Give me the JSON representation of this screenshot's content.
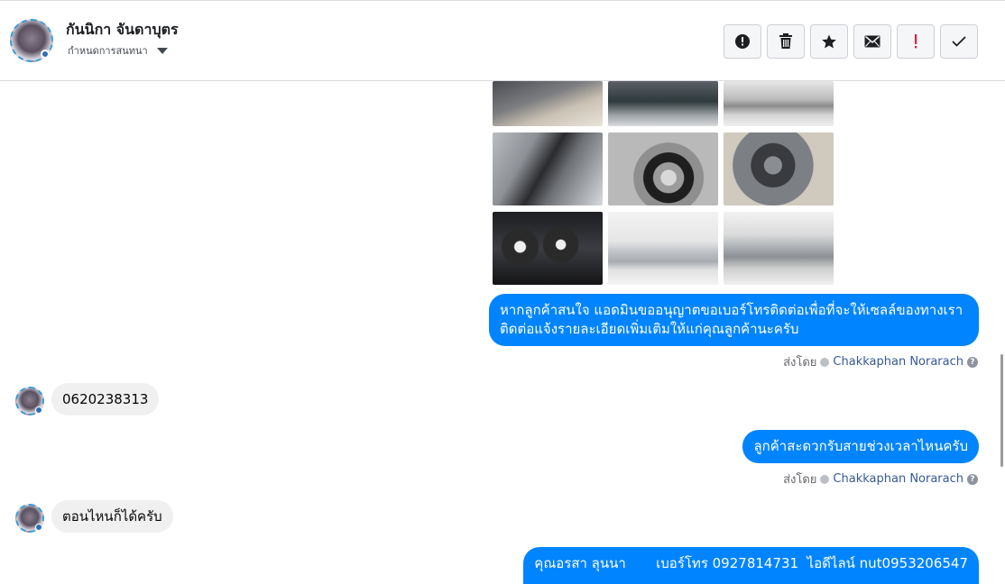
{
  "header": {
    "name": "กันนิกา จันดาบุตร",
    "subtitle": "กำหนดการสนทนา",
    "actions": [
      {
        "id": "spam",
        "icon": "alert-circle-icon"
      },
      {
        "id": "delete",
        "icon": "trash-icon"
      },
      {
        "id": "star",
        "icon": "star-icon"
      },
      {
        "id": "mail",
        "icon": "envelope-icon"
      },
      {
        "id": "important",
        "icon": "exclamation-icon"
      },
      {
        "id": "done",
        "icon": "check-icon"
      }
    ]
  },
  "messages": {
    "out_1_line1": "หากลูกค้าสนใจ แอดมินขออนุญาตขอเบอร์โทรติดต่อเพื่อที่จะให้เซลล์ของทางเรา",
    "out_1_line2": "ติดต่อแจ้งรายละเอียดเพิ่มเติมให้แก่คุณลูกค้านะครับ",
    "sent_by_label": "ส่งโดย",
    "sender_name": "Chakkaphan Norarach",
    "in_1": "0620238313",
    "out_2": "ลูกค้าสะดวกรับสายช่วงเวลาไหนครับ",
    "in_2": "ตอนไหนก็ได้ครับ",
    "out_3": "คุณอรสา ลุนนา       เบอร์โทร 0927814731  ไอดีไลน์ nut0953206547"
  },
  "colors": {
    "outgoing_bubble": "#0084ff",
    "incoming_bubble": "#f0f0f0",
    "sender_link": "#365899",
    "important_red": "#e41e3f"
  }
}
